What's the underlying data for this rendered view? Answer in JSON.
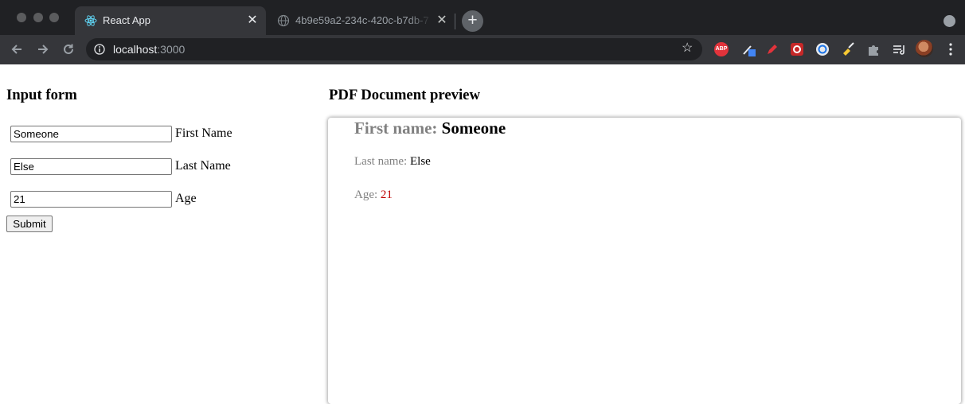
{
  "browser": {
    "tabs": [
      {
        "title": "React App",
        "icon": "react-icon",
        "active": true
      },
      {
        "title": "4b9e59a2-234c-420c-b7db-7",
        "icon": "globe-icon",
        "active": false
      }
    ],
    "new_tab_label": "+",
    "close_glyph": "✕",
    "url_host": "localhost",
    "url_port": ":3000",
    "bookmark_glyph": "☆",
    "extension_abp_label": "ABP",
    "colors": {
      "tabbar_bg": "#202124",
      "toolbar_bg": "#35363a",
      "omnibox_bg": "#202124"
    }
  },
  "form": {
    "heading": "Input form",
    "fields": [
      {
        "value": "Someone",
        "label": "First Name"
      },
      {
        "value": "Else",
        "label": "Last Name"
      },
      {
        "value": "21",
        "label": "Age"
      }
    ],
    "submit_label": "Submit"
  },
  "preview": {
    "heading": "PDF Document preview",
    "first_name_label": "First name:",
    "first_name_value": "Someone",
    "last_name_label": "Last name:",
    "last_name_value": "Else",
    "age_label": "Age:",
    "age_value": "21",
    "colors": {
      "label": "#808080",
      "age_value": "#c00000"
    }
  }
}
